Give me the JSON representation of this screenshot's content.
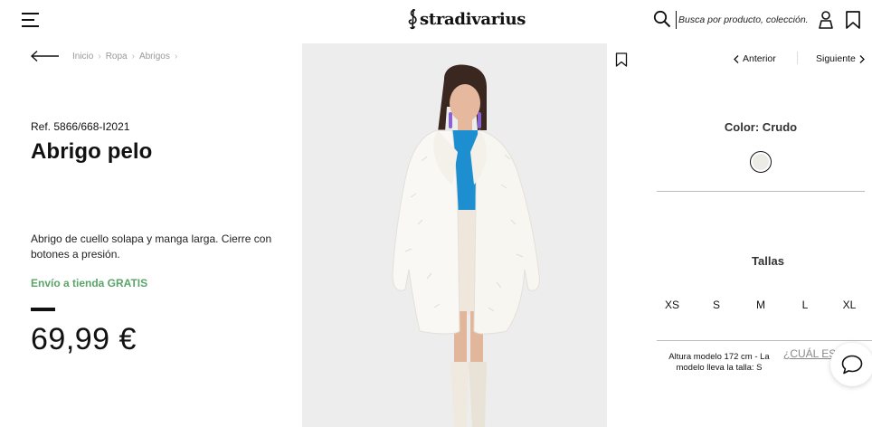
{
  "header": {
    "logo_text": "stradivarius",
    "search_placeholder": "Busca por producto, colección...",
    "icons": [
      "menu-icon",
      "search-icon",
      "user-icon",
      "bookmark-icon"
    ]
  },
  "breadcrumb": [
    "Inicio",
    "Ropa",
    "Abrigos"
  ],
  "product": {
    "ref": "Ref. 5866/668-I2021",
    "title": "Abrigo pelo",
    "description": "Abrigo de cuello solapa y manga larga. Cierre con botones a presión.",
    "shipping": "Envío a tienda GRATIS",
    "price": "69,99 €"
  },
  "nav": {
    "prev_label": "Anterior",
    "next_label": "Siguiente"
  },
  "color": {
    "label": "Color: Crudo",
    "swatch_hex": "#ecebe6"
  },
  "sizes": {
    "label": "Tallas",
    "options": [
      "XS",
      "S",
      "M",
      "L",
      "XL"
    ]
  },
  "model_info": "Altura modelo 172 cm - La modelo lleva la talla: S",
  "size_guide_label": "¿CUÁL ES TU TALLA?",
  "colors": {
    "shipping_green": "#5aa469",
    "photo_bg": "#ededed"
  }
}
